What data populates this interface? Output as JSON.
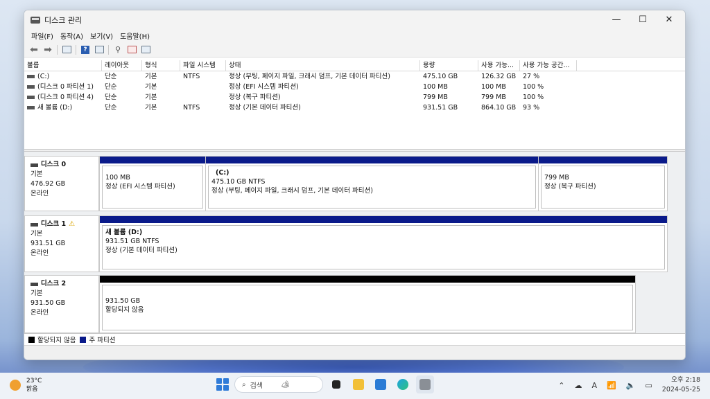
{
  "window": {
    "title": "디스크 관리",
    "minimize": "—",
    "maximize": "☐",
    "close": "✕"
  },
  "menu": [
    "파일(F)",
    "동작(A)",
    "보기(V)",
    "도움말(H)"
  ],
  "volume_table": {
    "headers": [
      "볼륨",
      "레이아웃",
      "형식",
      "파일 시스템",
      "상태",
      "용량",
      "사용 가능...",
      "사용 가능 공간..."
    ],
    "rows": [
      [
        "(C:)",
        "단순",
        "기본",
        "NTFS",
        "정상 (부팅, 페이지 파일, 크래시 덤프, 기본 데이터 파티션)",
        "475.10 GB",
        "126.32 GB",
        "27 %"
      ],
      [
        "(디스크 0 파티션 1)",
        "단순",
        "기본",
        "",
        "정상 (EFI 시스템 파티션)",
        "100 MB",
        "100 MB",
        "100 %"
      ],
      [
        "(디스크 0 파티션 4)",
        "단순",
        "기본",
        "",
        "정상 (복구 파티션)",
        "799 MB",
        "799 MB",
        "100 %"
      ],
      [
        "새 볼륨 (D:)",
        "단순",
        "기본",
        "NTFS",
        "정상 (기본 데이터 파티션)",
        "931.51 GB",
        "864.10 GB",
        "93 %"
      ]
    ]
  },
  "disks": [
    {
      "name": "디스크 0",
      "warning": false,
      "type": "기본",
      "size": "476.92 GB",
      "status": "온라인",
      "partitions": [
        {
          "name": "",
          "line1": "100 MB",
          "line2": "정상 (EFI 시스템 파티션)",
          "kind": "primary"
        },
        {
          "name": "(C:)",
          "line1": "475.10 GB NTFS",
          "line2": "정상 (부팅, 페이지 파일, 크래시 덤프, 기본 데이터 파티션)",
          "kind": "primary"
        },
        {
          "name": "",
          "line1": "799 MB",
          "line2": "정상 (복구 파티션)",
          "kind": "primary"
        }
      ]
    },
    {
      "name": "디스크 1",
      "warning": true,
      "type": "기본",
      "size": "931.51 GB",
      "status": "온라인",
      "partitions": [
        {
          "name": "새 볼륨  (D:)",
          "line1": "931.51 GB NTFS",
          "line2": "정상 (기본 데이터 파티션)",
          "kind": "primary"
        }
      ]
    },
    {
      "name": "디스크 2",
      "warning": false,
      "type": "기본",
      "size": "931.50 GB",
      "status": "온라인",
      "partitions": [
        {
          "name": "",
          "line1": "931.50 GB",
          "line2": "할당되지 않음",
          "kind": "unallocated"
        }
      ]
    }
  ],
  "legend": [
    {
      "label": "할당되지 않음",
      "color": "#000000"
    },
    {
      "label": "주 파티션",
      "color": "#0a1a8a"
    }
  ],
  "taskbar": {
    "weather_temp": "23°C",
    "weather_desc": "맑음",
    "search_placeholder": "검색",
    "time": "오후 2:18",
    "date": "2024-05-25"
  }
}
